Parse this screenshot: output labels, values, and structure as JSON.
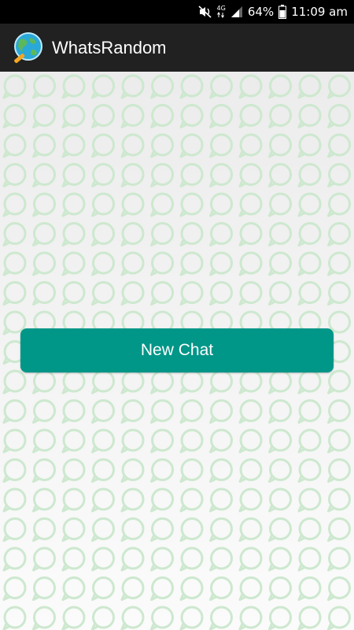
{
  "status_bar": {
    "network_label": "4G",
    "battery_percent": "64%",
    "time": "11:09 am"
  },
  "app_bar": {
    "title": "WhatsRandom",
    "logo_icon": "globe-magnifier-icon"
  },
  "main": {
    "new_chat_label": "New Chat",
    "button_color": "#009688",
    "pattern_color": "#cde8cf"
  }
}
